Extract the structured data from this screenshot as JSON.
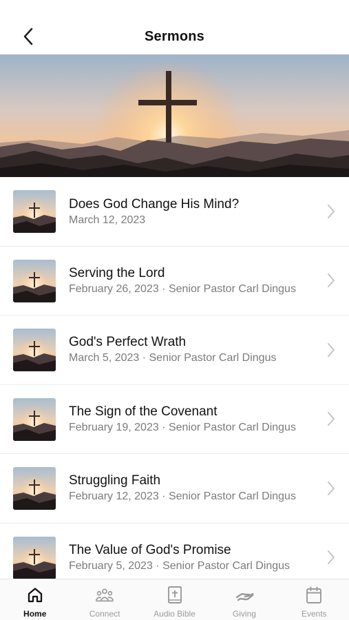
{
  "header": {
    "title": "Sermons"
  },
  "hero": {
    "image": "cross-on-mountain-sunset"
  },
  "sermons": [
    {
      "title": "Does God Change His Mind?",
      "subtitle": "March 12, 2023"
    },
    {
      "title": "Serving the Lord",
      "subtitle": "February 26, 2023 · Senior Pastor Carl Dingus"
    },
    {
      "title": "God's Perfect Wrath",
      "subtitle": "March 5, 2023 · Senior Pastor Carl Dingus"
    },
    {
      "title": "The Sign of the Covenant",
      "subtitle": "February 19, 2023 · Senior Pastor Carl Dingus"
    },
    {
      "title": "Struggling Faith",
      "subtitle": "February 12, 2023 · Senior Pastor Carl Dingus"
    },
    {
      "title": "The Value of God's Promise",
      "subtitle": "February 5, 2023 · Senior Pastor Carl Dingus"
    }
  ],
  "tabs": [
    {
      "label": "Home",
      "icon": "home-icon",
      "active": true
    },
    {
      "label": "Connect",
      "icon": "people-icon",
      "active": false
    },
    {
      "label": "Audio Bible",
      "icon": "bible-icon",
      "active": false
    },
    {
      "label": "Giving",
      "icon": "giving-hand-icon",
      "active": false
    },
    {
      "label": "Events",
      "icon": "calendar-icon",
      "active": false
    }
  ],
  "colors": {
    "active_tab": "#111111",
    "inactive_tab": "#9a9a9a",
    "subtitle": "#7b7b7b"
  }
}
